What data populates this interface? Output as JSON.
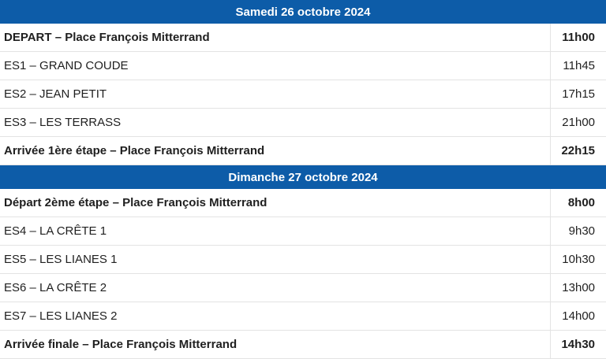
{
  "days": [
    {
      "header": "Samedi 26 octobre 2024",
      "rows": [
        {
          "label": "DEPART – Place François Mitterrand",
          "time": "11h00",
          "bold": true
        },
        {
          "label": "ES1 – GRAND COUDE",
          "time": "11h45",
          "bold": false
        },
        {
          "label": "ES2 – JEAN PETIT",
          "time": "17h15",
          "bold": false
        },
        {
          "label": "ES3 – LES TERRASS",
          "time": "21h00",
          "bold": false
        },
        {
          "label": "Arrivée 1ère étape – Place François Mitterrand",
          "time": "22h15",
          "bold": true
        }
      ]
    },
    {
      "header": "Dimanche 27 octobre 2024",
      "rows": [
        {
          "label": "Départ 2ème étape – Place François Mitterrand",
          "time": "8h00",
          "bold": true
        },
        {
          "label": "ES4 – LA CRÊTE 1",
          "time": "9h30",
          "bold": false
        },
        {
          "label": "ES5 – LES LIANES 1",
          "time": "10h30",
          "bold": false
        },
        {
          "label": "ES6 – LA CRÊTE 2",
          "time": "13h00",
          "bold": false
        },
        {
          "label": "ES7 – LES LIANES 2",
          "time": "14h00",
          "bold": false
        },
        {
          "label": "Arrivée finale – Place François Mitterrand",
          "time": "14h30",
          "bold": true
        }
      ]
    }
  ],
  "colors": {
    "header_bg": "#0d5ca8",
    "header_text": "#ffffff",
    "row_border": "#e3e3e3"
  }
}
